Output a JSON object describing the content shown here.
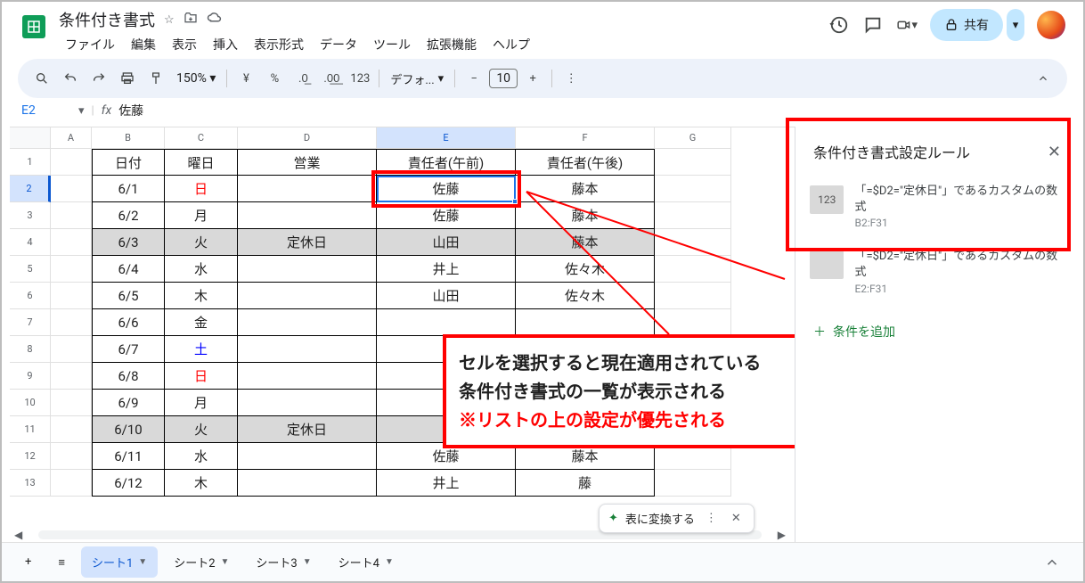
{
  "doc": {
    "title": "条件付き書式"
  },
  "menu": {
    "file": "ファイル",
    "edit": "編集",
    "view": "表示",
    "insert": "挿入",
    "format": "表示形式",
    "data": "データ",
    "tools": "ツール",
    "extensions": "拡張機能",
    "help": "ヘルプ"
  },
  "share": {
    "label": "共有"
  },
  "toolbar": {
    "zoom": "150%",
    "currency": "¥",
    "percent": "%",
    "dec_dec": ".0",
    "dec_inc": ".00",
    "num": "123",
    "font": "デフォ...",
    "size": "10"
  },
  "namebox": {
    "cell": "E2",
    "value": "佐藤"
  },
  "columns": {
    "A": "A",
    "B": "B",
    "C": "C",
    "D": "D",
    "E": "E",
    "F": "F",
    "G": "G"
  },
  "header_row": {
    "B": "日付",
    "C": "曜日",
    "D": "営業",
    "E": "責任者(午前)",
    "F": "責任者(午後)"
  },
  "rows": [
    {
      "n": "1"
    },
    {
      "n": "2",
      "B": "6/1",
      "C": "日",
      "C_cls": "red",
      "E": "佐藤",
      "F": "藤本"
    },
    {
      "n": "3",
      "B": "6/2",
      "C": "月",
      "E": "佐藤",
      "F": "藤本"
    },
    {
      "n": "4",
      "B": "6/3",
      "C": "火",
      "D": "定休日",
      "E": "山田",
      "F": "藤本",
      "gray": true
    },
    {
      "n": "5",
      "B": "6/4",
      "C": "水",
      "E": "井上",
      "F": "佐々木"
    },
    {
      "n": "6",
      "B": "6/5",
      "C": "木",
      "E": "山田",
      "F": "佐々木"
    },
    {
      "n": "7",
      "B": "6/6",
      "C": "金"
    },
    {
      "n": "8",
      "B": "6/7",
      "C": "土",
      "C_cls": "blue"
    },
    {
      "n": "9",
      "B": "6/8",
      "C": "日",
      "C_cls": "red"
    },
    {
      "n": "10",
      "B": "6/9",
      "C": "月"
    },
    {
      "n": "11",
      "B": "6/10",
      "C": "火",
      "D": "定休日",
      "gray": true
    },
    {
      "n": "12",
      "B": "6/11",
      "C": "水",
      "E": "佐藤",
      "F": "藤本"
    },
    {
      "n": "13",
      "B": "6/12",
      "C": "木",
      "E": "井上",
      "F": "藤"
    }
  ],
  "sidepanel": {
    "title": "条件付き書式設定ルール",
    "rules": [
      {
        "swatch": "123",
        "desc": "「=$D2=\"定休日\"」であるカスタムの数式",
        "range": "B2:F31"
      },
      {
        "swatch": "",
        "desc": "「=$D2=\"定休日\"」であるカスタムの数式",
        "range": "E2:F31"
      }
    ],
    "add": "条件を追加"
  },
  "callout": {
    "l1": "セルを選択すると現在適用されている",
    "l2": "条件付き書式の一覧が表示される",
    "l3": "※リストの上の設定が優先される"
  },
  "chip": {
    "label": "表に変換する"
  },
  "tabs": {
    "add": "+",
    "all": "≡",
    "s1": "シート1",
    "s2": "シート2",
    "s3": "シート3",
    "s4": "シート4"
  }
}
